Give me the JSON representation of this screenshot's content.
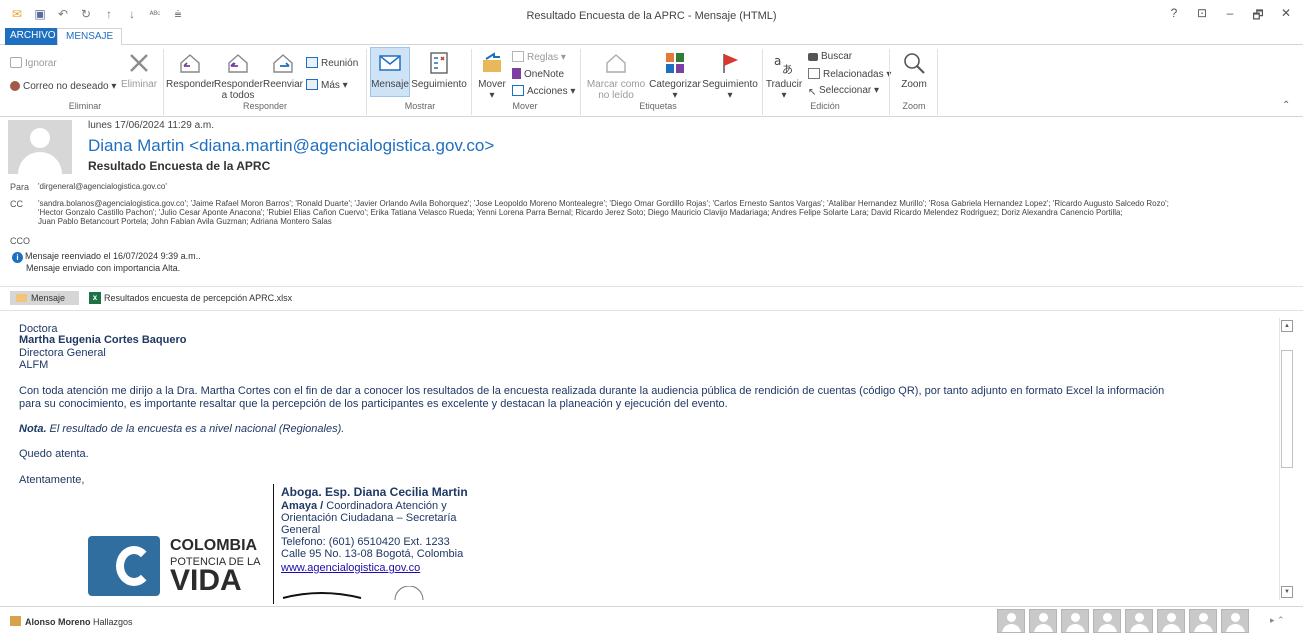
{
  "window": {
    "title": "Resultado Encuesta de la APRC - Mensaje (HTML)",
    "controls": [
      "?",
      "⊡",
      "–",
      "🗗",
      "✕"
    ]
  },
  "qat": [
    "envelope-icon",
    "save-icon",
    "undo-icon",
    "redo-icon",
    "up-icon",
    "down-icon",
    "spelling-icon",
    "customize-icon"
  ],
  "tabs": {
    "archivo": "ARCHIVO",
    "mensaje": "MENSAJE"
  },
  "ribbon": {
    "eliminar": {
      "ignorar": "Ignorar",
      "correo_no_deseado": "Correo no deseado",
      "eliminar": "Eliminar",
      "label": "Eliminar"
    },
    "responder": {
      "responder": "Responder",
      "responder_todos_1": "Responder",
      "responder_todos_2": "a todos",
      "reenviar": "Reenviar",
      "reunion": "Reunión",
      "mas": "Más",
      "label": "Responder"
    },
    "mostrar": {
      "mensaje": "Mensaje",
      "seguimiento": "Seguimiento",
      "label": "Mostrar"
    },
    "mover": {
      "mover": "Mover",
      "reglas": "Reglas",
      "onenote": "OneNote",
      "acciones": "Acciones",
      "label": "Mover"
    },
    "etiquetas": {
      "marcar_1": "Marcar como",
      "marcar_2": "no leído",
      "categorizar": "Categorizar",
      "seguimiento": "Seguimiento",
      "label": "Etiquetas"
    },
    "edicion": {
      "traducir": "Traducir",
      "buscar": "Buscar",
      "relacionadas": "Relacionadas",
      "seleccionar": "Seleccionar",
      "label": "Edición"
    },
    "zoom": {
      "zoom": "Zoom",
      "label": "Zoom"
    }
  },
  "header": {
    "date": "lunes 17/06/2024 11:29 a.m.",
    "sender": "Diana Martin <diana.martin@agencialogistica.gov.co>",
    "subject": "Resultado Encuesta de la APRC",
    "para_label": "Para",
    "para": "'dirgeneral@agencialogistica.gov.co'",
    "cc_label": "CC",
    "cc_line1": "'sandra.bolanos@agencialogistica.gov.co'; 'Jaime Rafael Moron Barros'; 'Ronald Duarte'; 'Javier Orlando Avila Bohorquez'; 'Jose Leopoldo Moreno Montealegre'; 'Diego Omar Gordillo Rojas'; 'Carlos Ernesto Santos Vargas'; 'Atalibar Hernandez Murillo'; 'Rosa Gabriela Hernandez Lopez'; 'Ricardo Augusto Salcedo Rozo';",
    "cc_line2": "'Hector Gonzalo Castillo Pachon'; 'Julio Cesar Aponte Anacona'; 'Rubiel Elias Cañon Cuervo'; Erika Tatiana Velasco Rueda; Yenni Lorena Parra Bernal; Ricardo Jerez Soto; Diego Mauricio Clavijo Madariaga; Andres Felipe Solarte Lara; David Ricardo Melendez Rodriguez; Doriz Alexandra Canencio Portilla;",
    "cc_line3": "Juan Pablo Betancourt Portela; John Fabian Avila Guzman; Adriana Montero Salas",
    "cco_label": "CCO",
    "info1": "Mensaje reenviado el 16/07/2024 9:39 a.m..",
    "info2": "Mensaje enviado con importancia Alta."
  },
  "attachments": {
    "message_tab": "Mensaje",
    "file": "Resultados encuesta de percepción APRC.xlsx"
  },
  "body": {
    "l1": "Doctora",
    "l2": "Martha Eugenia Cortes Baquero",
    "l3": "Directora General",
    "l4": "ALFM",
    "p1a": "Con toda atención me dirijo a la Dra. Martha Cortes con el fin de dar a conocer los resultados de la encuesta realizada durante la audiencia pública de rendición de cuentas (código QR), por tanto adjunto en formato Excel la información",
    "p1b": "para su conocimiento, es importante resaltar que la percepción de los participantes es excelente y destacan la planeación y ejecución del evento.",
    "nota_bold": "Nota.",
    "nota_rest": " El resultado de la encuesta es a nivel nacional (Regionales).",
    "quedo": "Quedo atenta.",
    "atentamente": "Atentamente,"
  },
  "signature": {
    "name1": "Aboga. Esp. Diana Cecilia Martin",
    "name2": "Amaya /",
    "role1": " Coordinadora Atención y",
    "role2": "Orientación Ciudadana – Secretaría",
    "role3": "General",
    "tel": "Telefono: (601) 6510420 Ext. 1233",
    "addr": "Calle 95 No. 13-08 Bogotá, Colombia",
    "web": "www.agencialogistica.gov.co",
    "logo1": "COLOMBIA",
    "logo2": "POTENCIA DE LA",
    "logo3": "VIDA"
  },
  "status": {
    "name": "Alonso Moreno",
    "detail": "Hallazgos"
  }
}
